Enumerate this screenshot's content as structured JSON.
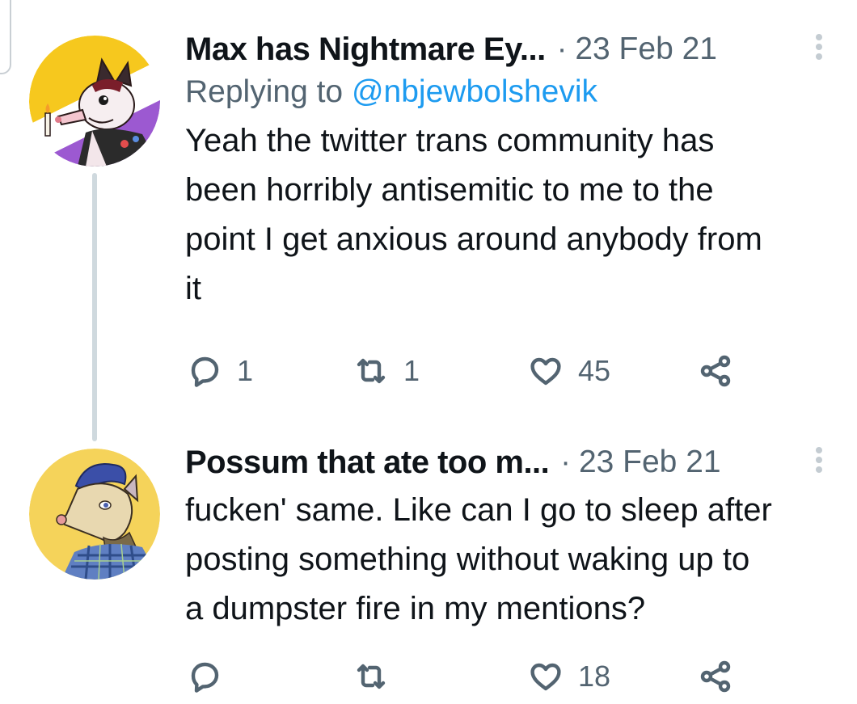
{
  "tweets": [
    {
      "display_name": "Max has Nightmare Ey...",
      "separator": "·",
      "timestamp": "23 Feb 21",
      "replying_prefix": "Replying to ",
      "replying_handle": "@nbjewbolshevik",
      "text": "Yeah the twitter trans community has\nbeen horribly antisemitic to me to the\npoint I get anxious around anybody from\nit",
      "reply_count": "1",
      "retweet_count": "1",
      "like_count": "45",
      "icons": {
        "avatar": "opossum-avatar-pride-flag",
        "reply": "reply-icon",
        "retweet": "retweet-icon",
        "like": "heart-icon",
        "share": "share-icon",
        "more": "more-vertical-icon"
      }
    },
    {
      "display_name": "Possum that ate too m...",
      "separator": "·",
      "timestamp": "23 Feb 21",
      "text": "fucken' same. Like can I go to sleep after\nposting something without waking up to\na dumpster fire in my mentions?",
      "reply_count": "",
      "retweet_count": "",
      "like_count": "18",
      "icons": {
        "avatar": "opossum-avatar-yellow",
        "reply": "reply-icon",
        "retweet": "retweet-icon",
        "like": "heart-icon",
        "share": "share-icon",
        "more": "more-vertical-icon"
      }
    }
  ],
  "colors": {
    "text_primary": "#0f1419",
    "text_secondary": "#536471",
    "link": "#1d9bf0",
    "thread_line": "#cfd9de",
    "avatar1_flag": [
      "#fcf434",
      "#ffffff",
      "#9c59d1",
      "#2c2c2c"
    ],
    "avatar2_bg": "#f5d35a"
  }
}
